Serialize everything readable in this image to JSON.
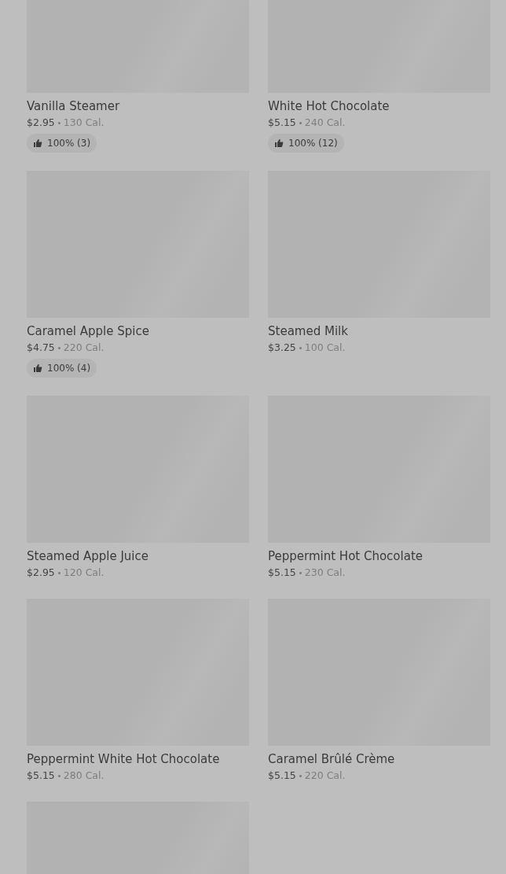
{
  "items": [
    {
      "name": "Vanilla Steamer",
      "price": "$2.95",
      "calories": "130 Cal.",
      "rating": "100% (3)",
      "image": {
        "kind": "placeholder"
      }
    },
    {
      "name": "White Hot Chocolate",
      "price": "$5.15",
      "calories": "240 Cal.",
      "rating": "100% (12)",
      "image": {
        "kind": "placeholder"
      }
    },
    {
      "name": "Caramel Apple Spice",
      "price": "$4.75",
      "calories": "220 Cal.",
      "rating": "100% (4)",
      "image": {
        "kind": "placeholder"
      }
    },
    {
      "name": "Steamed Milk",
      "price": "$3.25",
      "calories": "100 Cal.",
      "image": {
        "kind": "placeholder"
      }
    },
    {
      "name": "Steamed Apple Juice",
      "price": "$2.95",
      "calories": "120 Cal.",
      "image": {
        "kind": "placeholder"
      }
    },
    {
      "name": "Peppermint Hot Chocolate",
      "price": "$5.15",
      "calories": "230 Cal.",
      "image": {
        "kind": "placeholder"
      }
    },
    {
      "name": "Peppermint White Hot Chocolate",
      "price": "$5.15",
      "calories": "280 Cal.",
      "image": {
        "kind": "placeholder"
      }
    },
    {
      "name": "Caramel Brûlé Crème",
      "price": "$5.15",
      "calories": "220 Cal.",
      "image": {
        "kind": "placeholder"
      }
    },
    {
      "image": {
        "kind": "placeholder"
      }
    }
  ]
}
